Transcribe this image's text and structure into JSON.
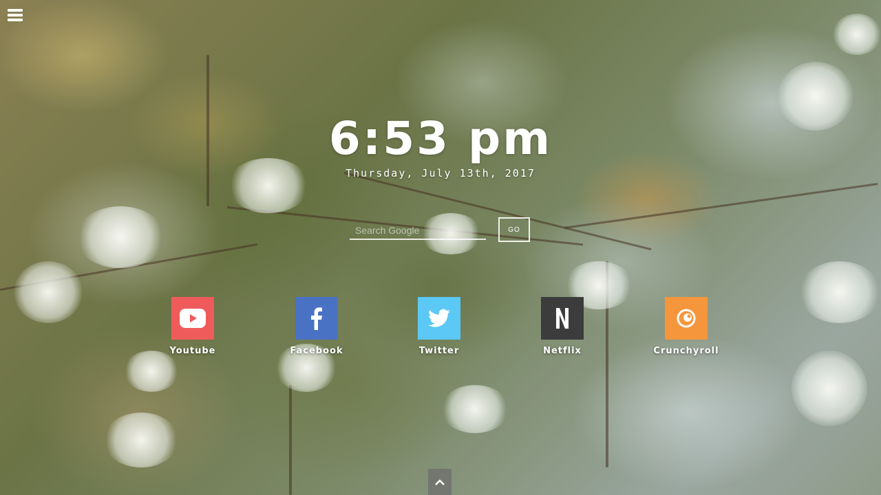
{
  "menu": {
    "icon": "hamburger-menu-icon"
  },
  "clock": {
    "time": "6:53 pm",
    "date": "Thursday, July 13th, 2017"
  },
  "search": {
    "placeholder": "Search Google",
    "button_label": "GO"
  },
  "shortcuts": [
    {
      "label": "Youtube",
      "icon": "youtube-icon",
      "color": "#ef5b5b"
    },
    {
      "label": "Facebook",
      "icon": "facebook-icon",
      "color": "#4a72c4"
    },
    {
      "label": "Twitter",
      "icon": "twitter-icon",
      "color": "#5bc8f5"
    },
    {
      "label": "Netflix",
      "icon": "netflix-icon",
      "color": "#3c3c3c"
    },
    {
      "label": "Crunchyroll",
      "icon": "crunchyroll-icon",
      "color": "#f5963c"
    }
  ],
  "scroll_up": {
    "icon": "chevron-up-icon"
  }
}
